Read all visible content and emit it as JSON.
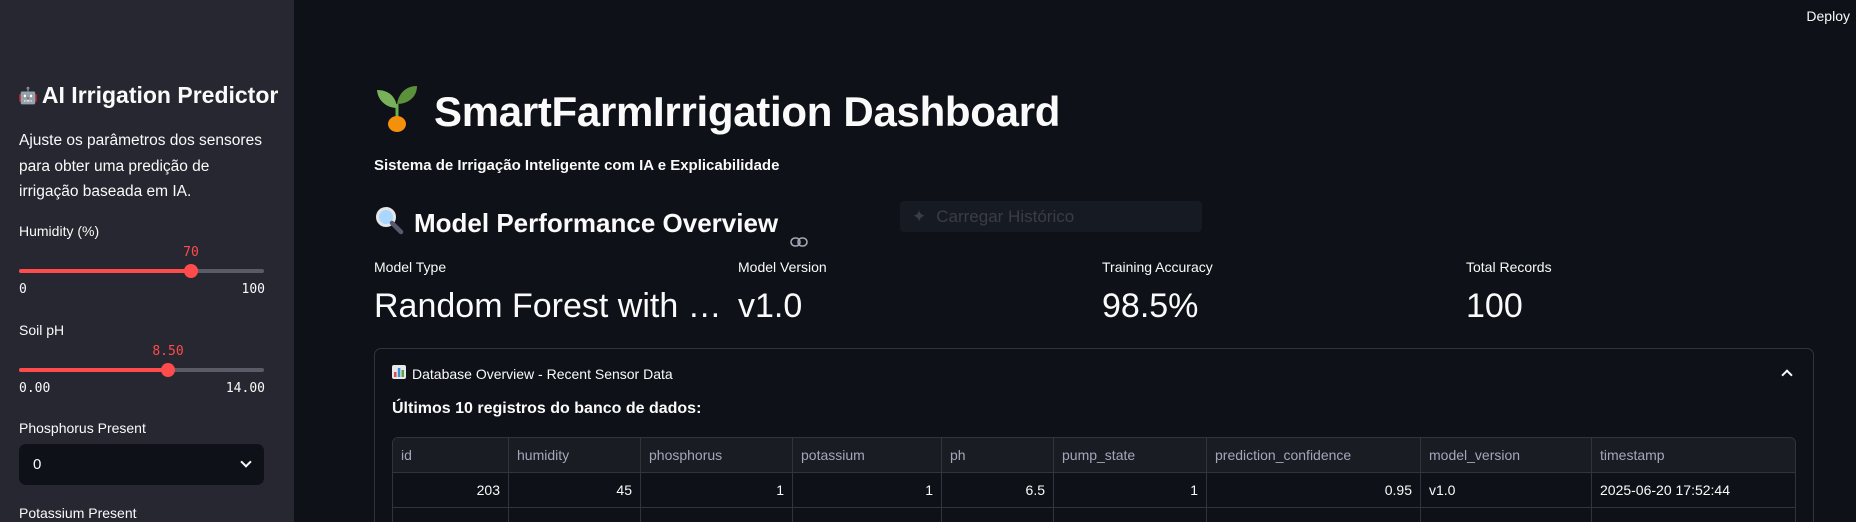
{
  "sidebar": {
    "title": "AI Irrigation Predictor",
    "title_icon": "robot-icon",
    "description": "Ajuste os parâmetros dos sensores para obter uma predição de irrigação baseada em IA.",
    "humidity": {
      "label": "Humidity (%)",
      "value": "70",
      "min": "0",
      "max": "100",
      "fraction": 0.7
    },
    "soil_ph": {
      "label": "Soil pH",
      "value": "8.50",
      "min": "0.00",
      "max": "14.00",
      "fraction": 0.607
    },
    "phosphorus": {
      "label": "Phosphorus Present",
      "value": "0"
    },
    "potassium": {
      "label": "Potassium Present"
    }
  },
  "header": {
    "deploy": "Deploy"
  },
  "main": {
    "title": "SmartFarmIrrigation Dashboard",
    "title_icon": "seedling-icon",
    "subtitle": "Sistema de Irrigação Inteligente com IA e Explicabilidade",
    "section_title": "Model Performance Overview",
    "section_icon": "magnifier-icon",
    "ghost_text": "Carregar Histórico",
    "metrics": [
      {
        "label": "Model Type",
        "value": "Random Forest with Explainability"
      },
      {
        "label": "Model Version",
        "value": "v1.0"
      },
      {
        "label": "Training Accuracy",
        "value": "98.5%"
      },
      {
        "label": "Total Records",
        "value": "100"
      }
    ],
    "expander": {
      "title": "Database Overview - Recent Sensor Data",
      "subheader": "Últimos 10 registros do banco de dados:",
      "columns": [
        "id",
        "humidity",
        "phosphorus",
        "potassium",
        "ph",
        "pump_state",
        "prediction_confidence",
        "model_version",
        "timestamp"
      ],
      "rows": [
        [
          "203",
          "45",
          "1",
          "1",
          "6.5",
          "1",
          "0.95",
          "v1.0",
          "2025-06-20 17:52:44"
        ],
        [
          "",
          "",
          "",
          "",
          "",
          "",
          "",
          "",
          ""
        ]
      ]
    }
  }
}
